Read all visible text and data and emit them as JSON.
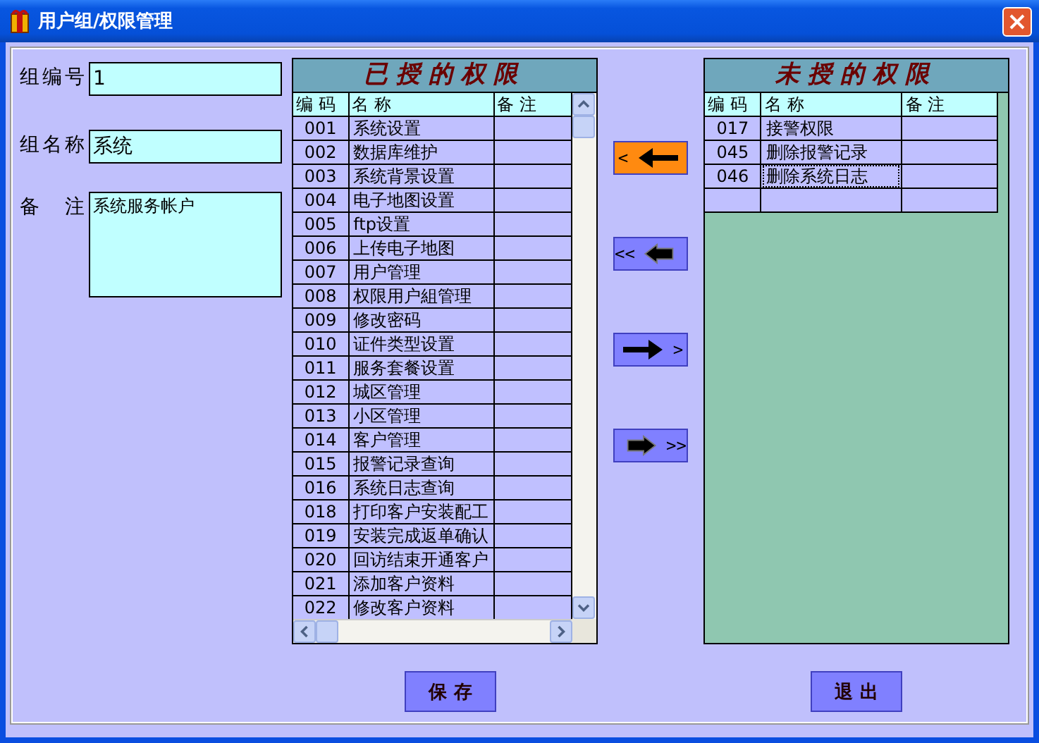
{
  "window": {
    "title": "用户组/权限管理"
  },
  "form": {
    "fields": [
      {
        "label": "组编号",
        "value": "1",
        "kind": "line"
      },
      {
        "label": "组名称",
        "value": "系统",
        "kind": "line"
      },
      {
        "label": "备 注",
        "value": "系统服务帐户",
        "kind": "area"
      }
    ]
  },
  "granted": {
    "title": "已授的权限",
    "columns": [
      "编 码",
      "名 称",
      "备 注"
    ],
    "kind": "scrolling",
    "rows": [
      {
        "kind": "record",
        "code": "001",
        "name": "系统设置",
        "focused": false
      },
      {
        "kind": "record",
        "code": "002",
        "name": "数据库维护",
        "focused": false
      },
      {
        "kind": "record",
        "code": "003",
        "name": "系统背景设置",
        "focused": false
      },
      {
        "kind": "record",
        "code": "004",
        "name": "电子地图设置",
        "focused": false
      },
      {
        "kind": "record",
        "code": "005",
        "name": "ftp设置",
        "focused": false
      },
      {
        "kind": "record",
        "code": "006",
        "name": "上传电子地图",
        "focused": false
      },
      {
        "kind": "record",
        "code": "007",
        "name": "用户管理",
        "focused": false
      },
      {
        "kind": "record",
        "code": "008",
        "name": "权限用户組管理",
        "focused": false
      },
      {
        "kind": "record",
        "code": "009",
        "name": "修改密码",
        "focused": false
      },
      {
        "kind": "record",
        "code": "010",
        "name": "证件类型设置",
        "focused": false
      },
      {
        "kind": "record",
        "code": "011",
        "name": "服务套餐设置",
        "focused": false
      },
      {
        "kind": "record",
        "code": "012",
        "name": "城区管理",
        "focused": false
      },
      {
        "kind": "record",
        "code": "013",
        "name": "小区管理",
        "focused": false
      },
      {
        "kind": "record",
        "code": "014",
        "name": "客户管理",
        "focused": false
      },
      {
        "kind": "record",
        "code": "015",
        "name": "报警记录查询",
        "focused": false
      },
      {
        "kind": "record",
        "code": "016",
        "name": "系统日志查询",
        "focused": false
      },
      {
        "kind": "record",
        "code": "018",
        "name": "打印客户安装配工",
        "focused": false
      },
      {
        "kind": "record",
        "code": "019",
        "name": "安装完成返单确认",
        "focused": false
      },
      {
        "kind": "record",
        "code": "020",
        "name": "回访结束开通客户",
        "focused": false
      },
      {
        "kind": "record",
        "code": "021",
        "name": "添加客户资料",
        "focused": false
      },
      {
        "kind": "record",
        "code": "022",
        "name": "修改客户资料",
        "focused": false
      }
    ]
  },
  "move_buttons": [
    {
      "label": "<",
      "kind": "left",
      "selected": true
    },
    {
      "label": "<<",
      "kind": "left_all",
      "selected": false
    },
    {
      "label": ">",
      "kind": "right",
      "selected": false
    },
    {
      "label": ">>",
      "kind": "right_all",
      "selected": false
    }
  ],
  "ungranted": {
    "title": "未授的权限",
    "columns": [
      "编 码",
      "名 称",
      "备 注"
    ],
    "kind": "fixed",
    "rows": [
      {
        "kind": "record",
        "code": "017",
        "name": "接警权限",
        "focused": false
      },
      {
        "kind": "record",
        "code": "045",
        "name": "删除报警记录",
        "focused": false
      },
      {
        "kind": "record",
        "code": "046",
        "name": "删除系统日志",
        "focused": true
      },
      {
        "kind": "blank"
      }
    ]
  },
  "footer_buttons": [
    "保 存",
    "退 出"
  ]
}
